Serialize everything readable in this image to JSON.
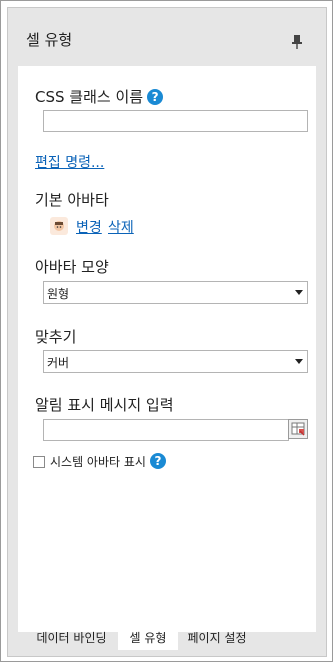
{
  "panel": {
    "title": "셀 유형"
  },
  "css_class": {
    "label": "CSS 클래스 이름",
    "help": "?",
    "value": ""
  },
  "edit_commands": {
    "label": "편집 명령..."
  },
  "default_avatar": {
    "label": "기본 아바타",
    "change": "변경",
    "delete": "삭제"
  },
  "avatar_shape": {
    "label": "아바타 모양",
    "selected": "원형"
  },
  "fit": {
    "label": "맞추기",
    "selected": "커버"
  },
  "notification": {
    "label": "알림 표시 메시지 입력",
    "value": ""
  },
  "system_avatar": {
    "label": "시스템 아바타 표시",
    "help": "?",
    "checked": false
  },
  "tabs": [
    {
      "label": "데이터 바인딩",
      "active": false
    },
    {
      "label": "셀 유형",
      "active": true
    },
    {
      "label": "페이지 설정",
      "active": false
    }
  ],
  "colors": {
    "accent": "#1a8ad4",
    "link": "#0b63b8",
    "panel_bg": "#e6e6e6"
  }
}
